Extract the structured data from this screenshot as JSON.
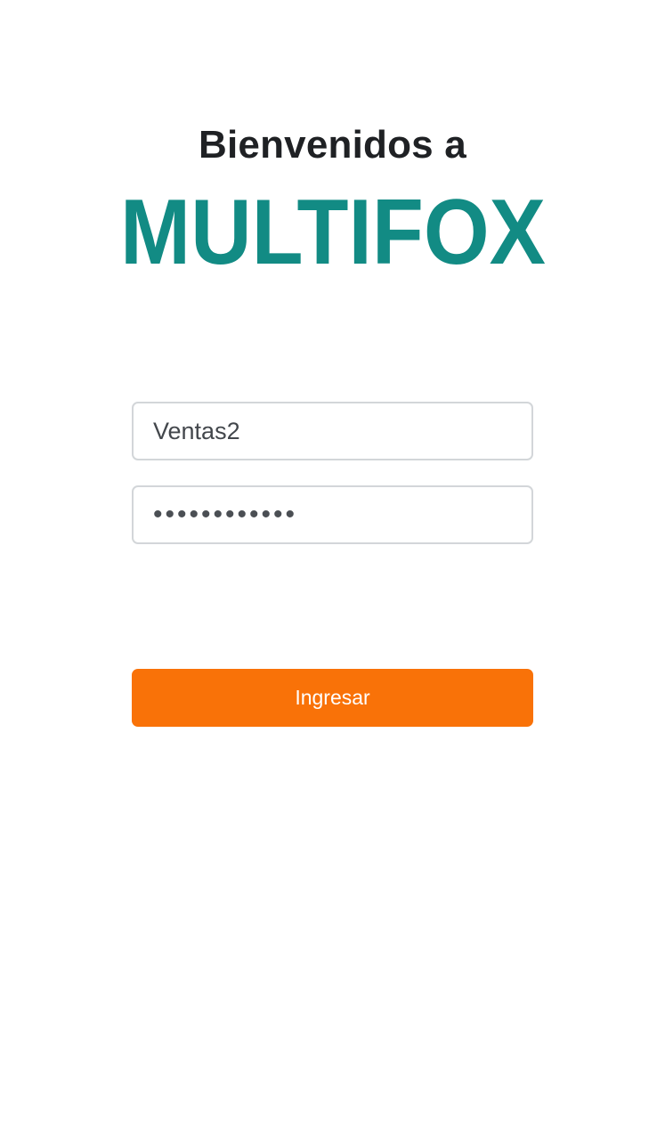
{
  "header": {
    "welcome_text": "Bienvenidos a"
  },
  "logo": {
    "brand_text": "MULTIFOX",
    "color": "#128b84"
  },
  "login_form": {
    "username_value": "Ventas2",
    "password_value": "••••••••••••",
    "submit_label": "Ingresar",
    "accent_color": "#f97208"
  }
}
